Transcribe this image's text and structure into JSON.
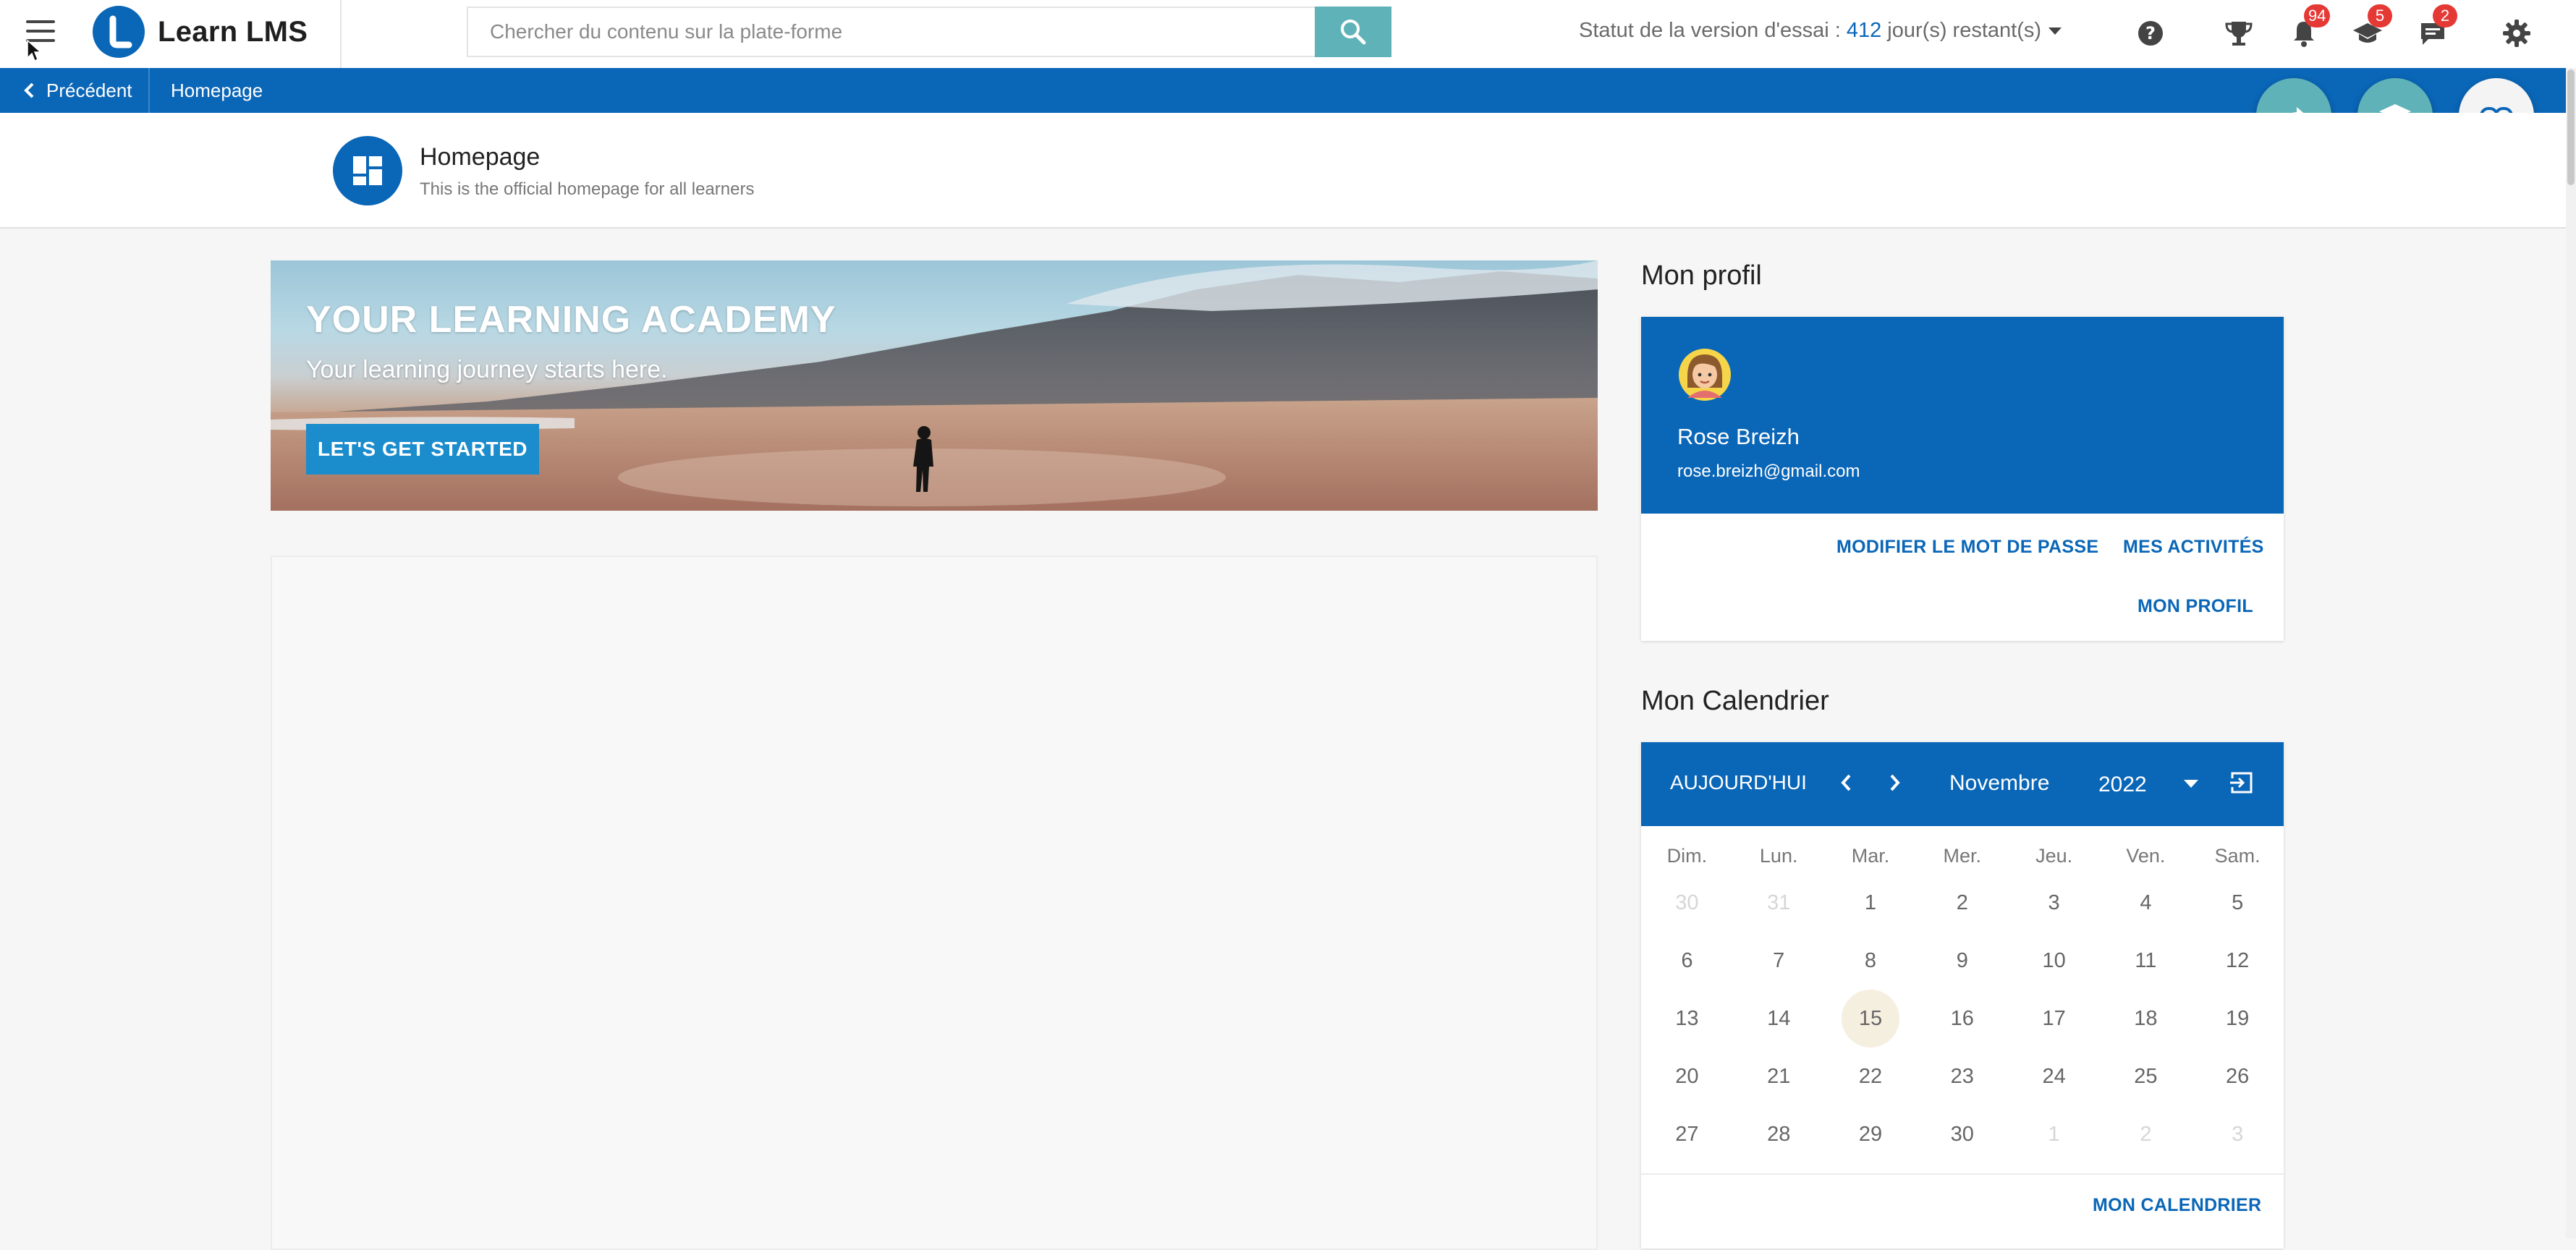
{
  "header": {
    "brand_name": "Learn LMS",
    "search_placeholder": "Chercher du contenu sur la plate-forme",
    "trial_prefix": "Statut de la version d'essai : ",
    "trial_days": "412",
    "trial_suffix": " jour(s) restant(s)",
    "icons": [
      "help-icon",
      "trophy-icon",
      "bell-icon",
      "graduation-icon",
      "chat-icon",
      "gear-icon"
    ],
    "badges": {
      "notifications": "94",
      "courses": "5",
      "messages": "2"
    }
  },
  "breadcrumb": {
    "back_label": "Précédent",
    "current": "Homepage"
  },
  "page": {
    "title": "Homepage",
    "subtitle": "This is the official homepage for all learners"
  },
  "hero": {
    "title": "YOUR LEARNING ACADEMY",
    "subtitle": "Your learning journey starts here.",
    "button_label": "LET'S GET STARTED"
  },
  "profile": {
    "section_title": "Mon profil",
    "name": "Rose Breizh",
    "email": "rose.breizh@gmail.com",
    "links": {
      "change_password": "MODIFIER LE MOT DE PASSE",
      "activities": "MES ACTIVITÉS",
      "profile": "MON PROFIL"
    }
  },
  "calendar": {
    "section_title": "Mon Calendrier",
    "today_label": "AUJOURD'HUI",
    "month": "Novembre",
    "year": "2022",
    "weekdays": [
      "Dim.",
      "Lun.",
      "Mar.",
      "Mer.",
      "Jeu.",
      "Ven.",
      "Sam."
    ],
    "weeks": [
      [
        "30",
        "31",
        "1",
        "2",
        "3",
        "4",
        "5"
      ],
      [
        "6",
        "7",
        "8",
        "9",
        "10",
        "11",
        "12"
      ],
      [
        "13",
        "14",
        "15",
        "16",
        "17",
        "18",
        "19"
      ],
      [
        "20",
        "21",
        "22",
        "23",
        "24",
        "25",
        "26"
      ],
      [
        "27",
        "28",
        "29",
        "30",
        "1",
        "2",
        "3"
      ]
    ],
    "today": "15",
    "footer_link": "MON CALENDRIER"
  },
  "colors": {
    "primary": "#0a66b7",
    "search_button": "#5fb3b8",
    "fab_teal": "#5fb3b8",
    "badge": "#e53935"
  }
}
